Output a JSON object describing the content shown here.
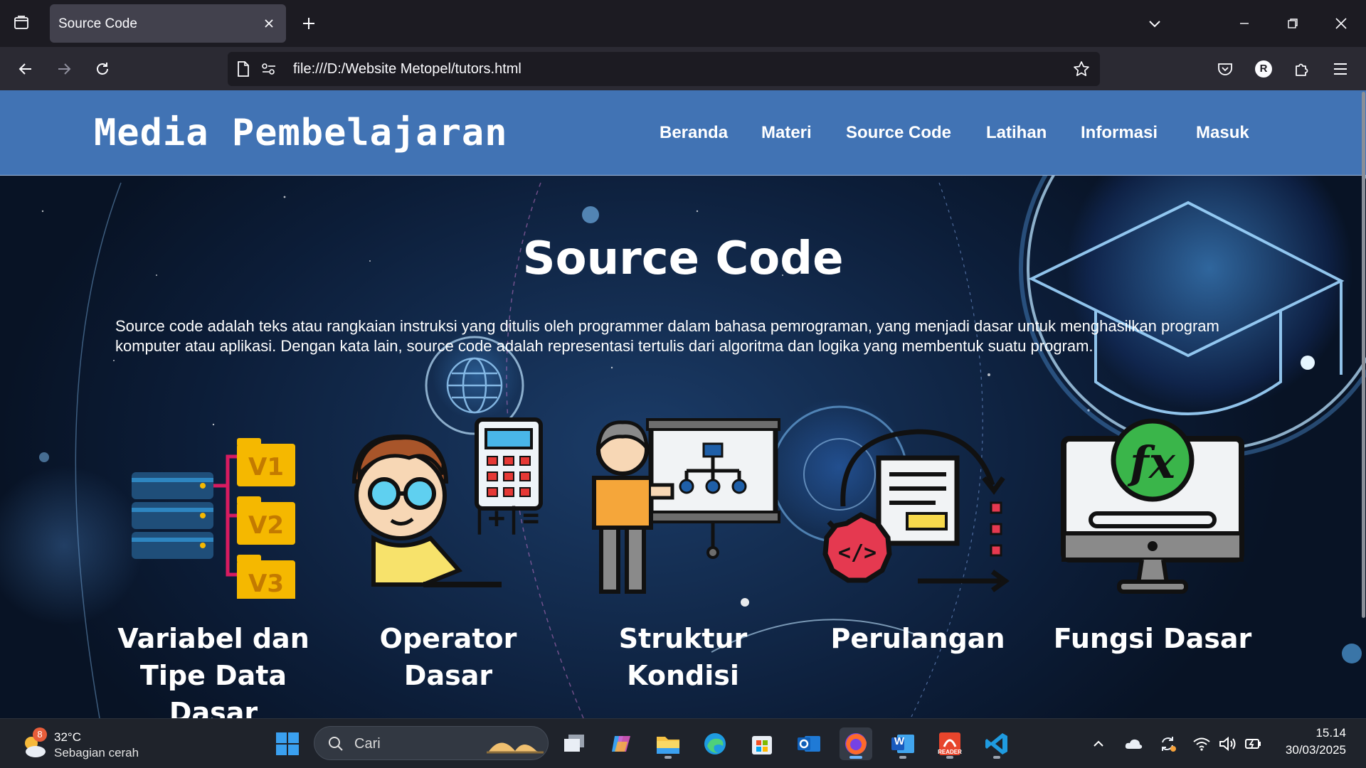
{
  "browser": {
    "tab_title": "Source Code",
    "url": "file:///D:/Website Metopel/tutors.html"
  },
  "site": {
    "logo": "Media Pembelajaran",
    "nav": [
      "Beranda",
      "Materi",
      "Source Code",
      "Latihan",
      "Informasi",
      "Masuk"
    ],
    "header_color": "#4173b4"
  },
  "hero": {
    "title": "Source Code",
    "description": "Source code adalah teks atau rangkaian instruksi yang ditulis oleh programmer dalam bahasa pemrograman, yang menjadi dasar untuk menghasilkan program komputer atau aplikasi. Dengan kata lain, source code adalah representasi tertulis dari algoritma dan logika yang membentuk suatu program."
  },
  "cards": [
    {
      "title": "Variabel dan Tipe Data Dasar",
      "icon": "database-versions-icon"
    },
    {
      "title": "Operator Dasar",
      "icon": "student-calculator-icon"
    },
    {
      "title": "Struktur Kondisi",
      "icon": "presenter-flowchart-icon"
    },
    {
      "title": "Perulangan",
      "icon": "code-loop-icon"
    },
    {
      "title": "Fungsi Dasar",
      "icon": "monitor-function-icon"
    }
  ],
  "card_labels": {
    "v1": "V1",
    "v2": "V2",
    "v3": "V3",
    "ops": "|+|=",
    "code": "</>",
    "fx": "fx"
  },
  "taskbar": {
    "weather_badge": "8",
    "weather_temp": "32°C",
    "weather_desc": "Sebagian cerah",
    "search_placeholder": "Cari",
    "word_letter": "W",
    "reader_label": "READER",
    "time": "15.14",
    "date": "30/03/2025",
    "profile_initial": "R"
  }
}
